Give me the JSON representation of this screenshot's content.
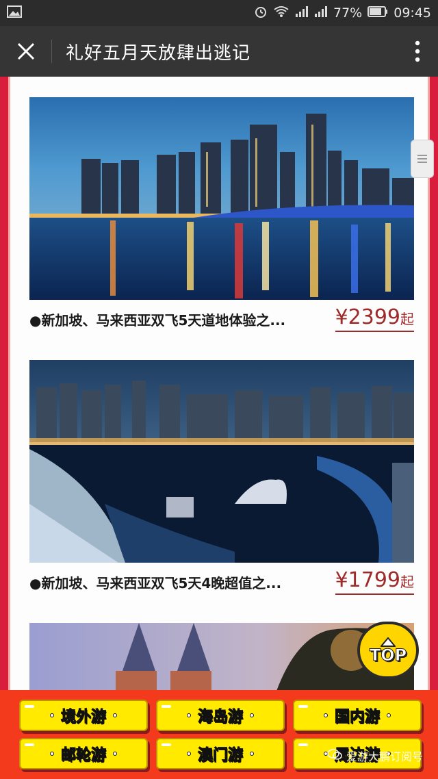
{
  "status_bar": {
    "battery": "77%",
    "time": "09:45"
  },
  "header": {
    "title": "礼好五月天放肆出逃记"
  },
  "products": [
    {
      "name": "●新加坡、马来西亚双飞5天道地体验之...",
      "price": "¥2399",
      "unit": "起"
    },
    {
      "name": "●新加坡、马来西亚双飞5天4晚超值之...",
      "price": "¥1799",
      "unit": "起"
    }
  ],
  "top_button": {
    "label": "TOP"
  },
  "bottom_nav": [
    "境外游",
    "海岛游",
    "国内游",
    "邮轮游",
    "澳门游",
    "周边游"
  ],
  "watermark": {
    "text": "爱游大鹏订阅号"
  },
  "colors": {
    "page_bg": "#d81e3c",
    "nav_bg": "#f33a1d",
    "button_yellow": "#ffea00",
    "price_color": "#9e2a2a"
  }
}
